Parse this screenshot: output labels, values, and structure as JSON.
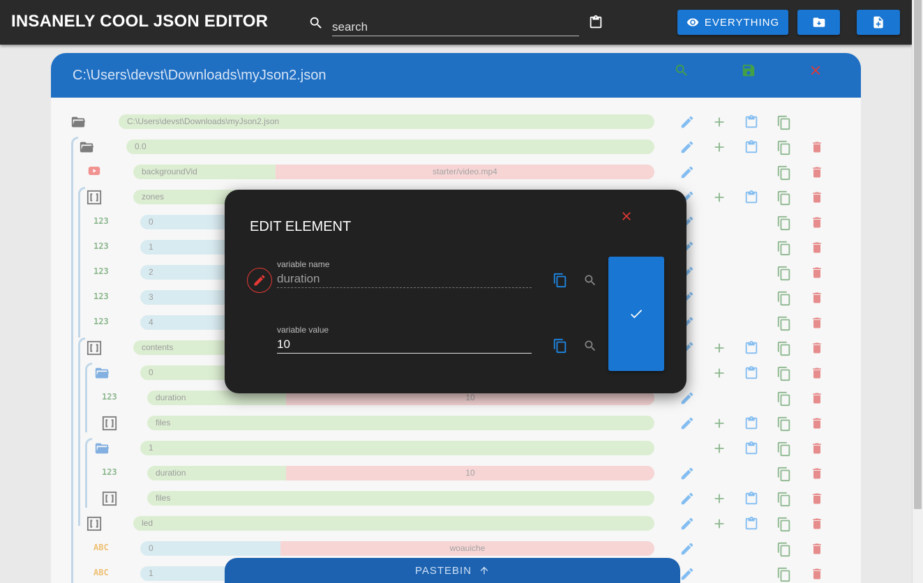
{
  "app": {
    "title": "INSANELY COOL JSON EDITOR",
    "search_placeholder": "search",
    "everything_label": "EVERYTHING"
  },
  "panel": {
    "title": "C:\\Users\\devst\\Downloads\\myJson2.json"
  },
  "tree": [
    {
      "icon": "folder-open-icon",
      "key": "C:\\Users\\devst\\Downloads\\myJson2.json",
      "value": "",
      "type": "root"
    },
    {
      "icon": "folder-open-icon",
      "key": "0.0",
      "value": "",
      "type": "object"
    },
    {
      "icon": "youtube-icon",
      "key": "backgroundVid",
      "value": "starter/video.mp4",
      "type": "video"
    },
    {
      "icon": "array-icon",
      "key": "zones",
      "value": "",
      "type": "array"
    },
    {
      "icon": "number-icon",
      "key": "0",
      "value": "",
      "type": "number"
    },
    {
      "icon": "number-icon",
      "key": "1",
      "value": "",
      "type": "number"
    },
    {
      "icon": "number-icon",
      "key": "2",
      "value": "",
      "type": "number"
    },
    {
      "icon": "number-icon",
      "key": "3",
      "value": "",
      "type": "number"
    },
    {
      "icon": "number-icon",
      "key": "4",
      "value": "",
      "type": "number"
    },
    {
      "icon": "array-icon",
      "key": "contents",
      "value": "",
      "type": "array"
    },
    {
      "icon": "folder-open-icon",
      "key": "0",
      "value": "",
      "type": "object"
    },
    {
      "icon": "number-icon",
      "key": "duration",
      "value": "10",
      "type": "number"
    },
    {
      "icon": "array-icon",
      "key": "files",
      "value": "",
      "type": "array"
    },
    {
      "icon": "folder-open-icon",
      "key": "1",
      "value": "",
      "type": "object"
    },
    {
      "icon": "number-icon",
      "key": "duration",
      "value": "10",
      "type": "number"
    },
    {
      "icon": "array-icon",
      "key": "files",
      "value": "",
      "type": "array"
    },
    {
      "icon": "array-icon",
      "key": "led",
      "value": "",
      "type": "array"
    },
    {
      "icon": "string-icon",
      "key": "0",
      "value": "woauiche",
      "type": "string"
    },
    {
      "icon": "string-icon",
      "key": "1",
      "value": "",
      "type": "string"
    }
  ],
  "type_badges": {
    "number": "123",
    "string": "ABC"
  },
  "dialog": {
    "title": "EDIT ELEMENT",
    "name_label": "variable name",
    "name_value": "duration",
    "value_label": "variable value",
    "value_value": "10"
  },
  "pastebin_label": "PASTEBIN",
  "colors": {
    "accent": "#1976d2",
    "delete": "#d32f2f",
    "add": "#2e7d32",
    "topbar": "#2a2a2a",
    "dialog": "#212121"
  }
}
